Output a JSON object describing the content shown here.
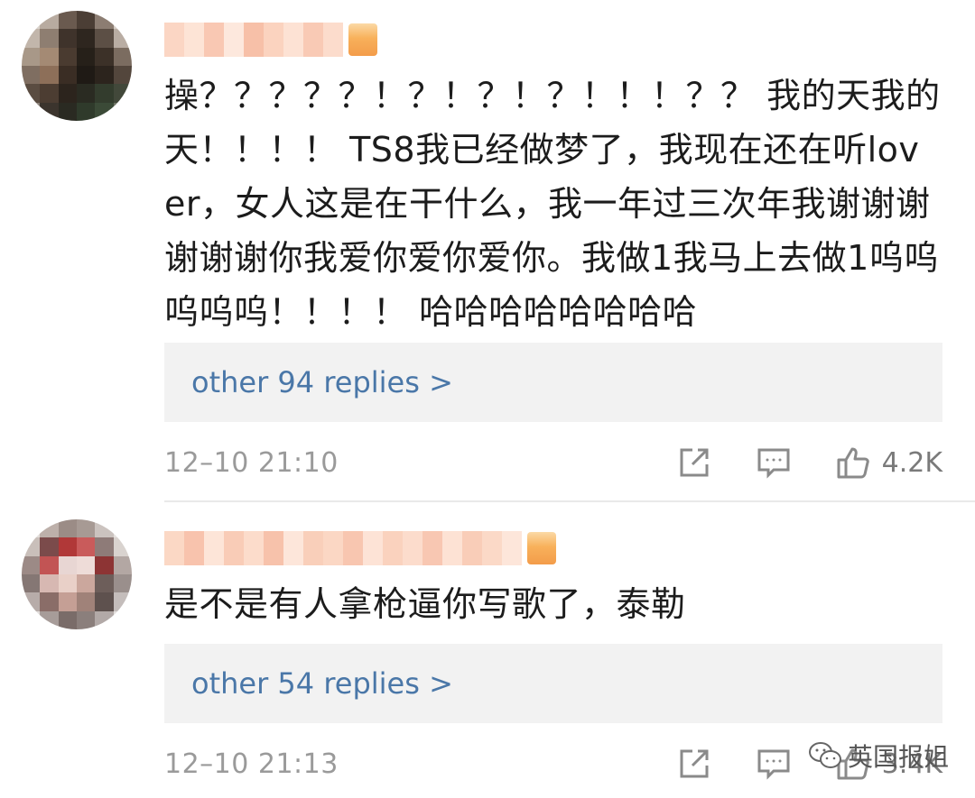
{
  "comments": [
    {
      "text": "操？？？？？！？！？！？！！！？？ 我的天我的天！！！！ TS8我已经做梦了，我现在还在听lover，女人这是在干什么，我一年过三次年我谢谢谢谢谢谢你我爱你爱你爱你。我做1我马上去做1呜呜呜呜呜！！！！ 哈哈哈哈哈哈哈哈",
      "replies_label": "other 94 replies >",
      "timestamp": "12–10 21:10",
      "like_count": "4.2K"
    },
    {
      "text": "是不是有人拿枪逼你写歌了，泰勒",
      "replies_label": "other 54 replies >",
      "timestamp": "12–10 21:13",
      "like_count": "3.4K"
    }
  ],
  "icons": {
    "share": "share-icon",
    "comment": "comment-icon",
    "like": "thumbs-up-icon",
    "watermark": "wechat-icon"
  },
  "watermark": {
    "label": "英国报姐"
  },
  "colors": {
    "link": "#4a77a8",
    "replies_bg": "#f2f2f2",
    "meta": "#9a9a9a",
    "text": "#1c1c1c"
  }
}
